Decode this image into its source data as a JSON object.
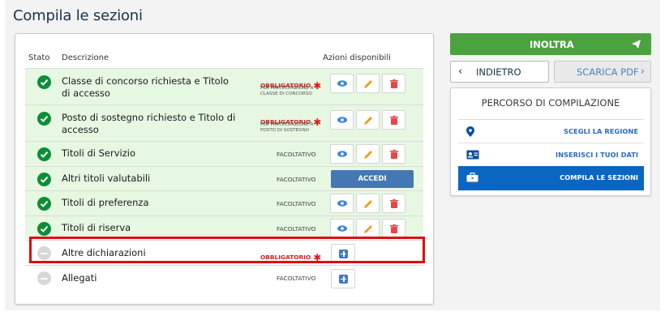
{
  "page_title": "Compila le sezioni",
  "table": {
    "headers": {
      "stato": "Stato",
      "descrizione": "Descrizione",
      "azioni": "Azioni disponibili"
    },
    "rows": [
      {
        "description": "Classe di concorso richiesta e Titolo di accesso",
        "requirement": "OBBLIGATORIO",
        "note": "PER PARTECIPAZIONE A CLASSE DI CONCORSO",
        "status": "completed"
      },
      {
        "description": "Posto di sostegno richiesto e Titolo di accesso",
        "requirement": "OBBLIGATORIO",
        "note": "PER PARTECIPAZIONE A POSTO DI SOSTEGNO",
        "status": "completed"
      },
      {
        "description": "Titoli di Servizio",
        "requirement": "FACOLTATIVO",
        "status": "completed"
      },
      {
        "description": "Altri titoli valutabili",
        "requirement": "FACOLTATIVO",
        "status": "completed",
        "action": "ACCEDI"
      },
      {
        "description": "Titoli di preferenza",
        "requirement": "FACOLTATIVO",
        "status": "completed"
      },
      {
        "description": "Titoli di riserva",
        "requirement": "FACOLTATIVO",
        "status": "completed"
      },
      {
        "description": "Altre dichiarazioni",
        "requirement": "OBBLIGATORIO",
        "status": "not-started",
        "highlighted": true
      },
      {
        "description": "Allegati",
        "requirement": "FACOLTATIVO",
        "status": "not-started"
      }
    ]
  },
  "actions": {
    "inoltra": "INOLTRA",
    "indietro": "INDIETRO",
    "scarica_pdf": "SCARICA PDF"
  },
  "percorso": {
    "title": "PERCORSO DI COMPILAZIONE",
    "steps": [
      {
        "label": "SCEGLI LA REGIONE",
        "icon": "map-pin-icon",
        "active": false
      },
      {
        "label": "INSERISCI I TUOI DATI",
        "icon": "id-card-icon",
        "active": false
      },
      {
        "label": "COMPILA LE SEZIONI",
        "icon": "briefcase-icon",
        "active": true
      }
    ]
  },
  "colors": {
    "completed": "#0b8e36",
    "row_completed_bg": "#e6f7e2",
    "required": "#d1211d",
    "primary": "#0a66c2",
    "success_button": "#4ba33f",
    "highlight": "#e00b0b"
  }
}
